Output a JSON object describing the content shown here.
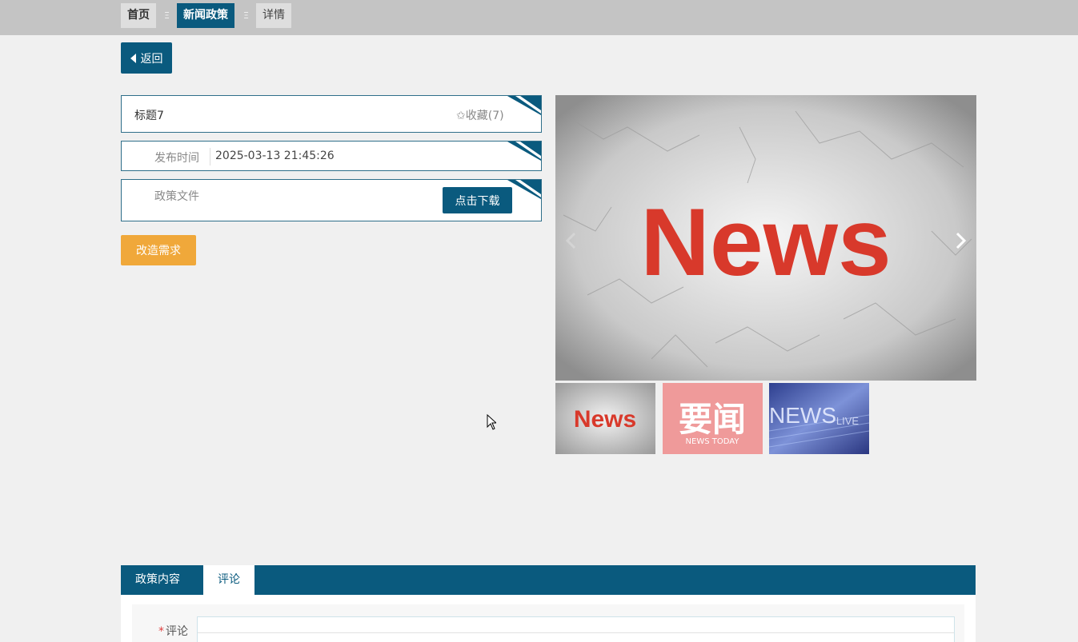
{
  "breadcrumb": {
    "items": [
      "首页",
      "新闻政策",
      "详情"
    ],
    "separator": "Ξ"
  },
  "back_button": {
    "label": "返回"
  },
  "detail": {
    "title": "标题7",
    "favorite_label": "✩收藏(7)",
    "publish_time_label": "发布时间",
    "publish_time_value": "2025-03-13 21:45:26",
    "policy_file_label": "政策文件",
    "download_label": "点击下载"
  },
  "modify_button": {
    "label": "改造需求"
  },
  "gallery": {
    "main_image_text": "News",
    "thumbnails": [
      {
        "icon": "news-thumbnail",
        "text": "News"
      },
      {
        "icon": "yaowen-thumbnail",
        "text": "要闻",
        "subtext": "NEWS TODAY"
      },
      {
        "icon": "news-live-thumbnail",
        "text": "NEWS",
        "subtext": "LIVE"
      }
    ]
  },
  "tabs": [
    {
      "label": "政策内容",
      "active": false
    },
    {
      "label": "评论",
      "active": true
    }
  ],
  "comment": {
    "required_mark": "*",
    "label": "评论"
  },
  "colors": {
    "primary": "#0a5a7e",
    "accent": "#f0a83a",
    "topbar": "#c4c4c4",
    "background": "#f0f0f0"
  }
}
